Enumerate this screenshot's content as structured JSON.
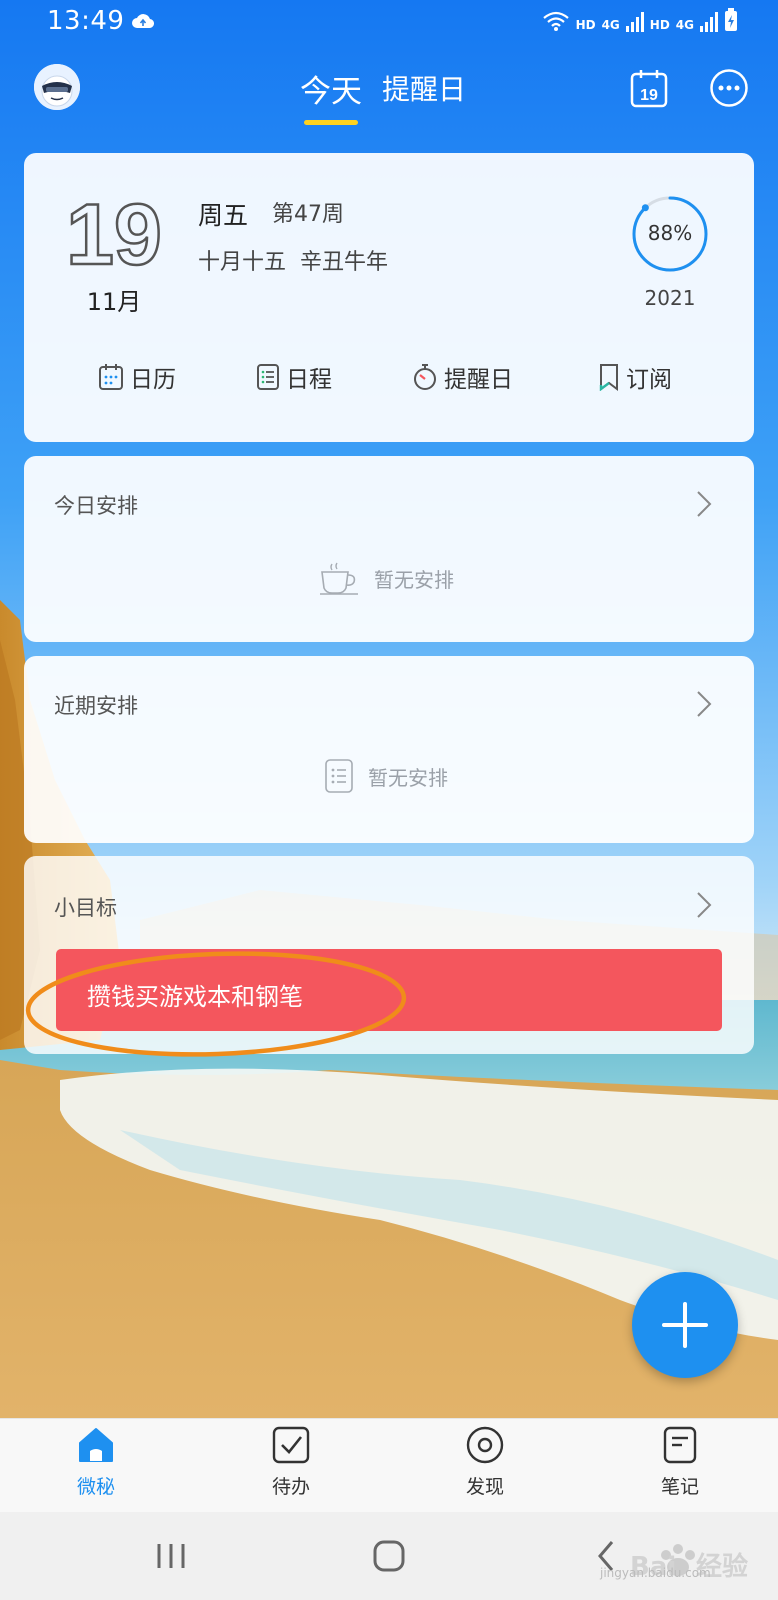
{
  "status_bar": {
    "time": "13:49",
    "network_labels": [
      "HD",
      "4G",
      "HD",
      "4G"
    ]
  },
  "header": {
    "tabs": [
      {
        "label": "今天",
        "active": true
      },
      {
        "label": "提醒日",
        "active": false
      }
    ],
    "calendar_icon_day": "19"
  },
  "date_card": {
    "day": "19",
    "month": "11月",
    "weekday": "周五",
    "week_number": "第47周",
    "lunar": "十月十五  辛丑牛年",
    "year_progress": 0.88,
    "year_progress_label": "88%",
    "year": "2021",
    "shortcuts": [
      {
        "label": "日历",
        "icon": "calendar-icon"
      },
      {
        "label": "日程",
        "icon": "schedule-list-icon"
      },
      {
        "label": "提醒日",
        "icon": "timer-icon"
      },
      {
        "label": "订阅",
        "icon": "bookmark-icon"
      }
    ]
  },
  "today_section": {
    "title": "今日安排",
    "empty_text": "暂无安排"
  },
  "recent_section": {
    "title": "近期安排",
    "empty_text": "暂无安排"
  },
  "goals_section": {
    "title": "小目标",
    "goal_item": "攒钱买游戏本和钢笔"
  },
  "bottom_nav": [
    {
      "label": "微秘",
      "active": true
    },
    {
      "label": "待办",
      "active": false
    },
    {
      "label": "发现",
      "active": false
    },
    {
      "label": "笔记",
      "active": false
    }
  ],
  "colors": {
    "accent": "#1e90f0",
    "tab_underline": "#ffd21f",
    "goal_bg": "#f4565d",
    "annotation": "#f08c1a"
  },
  "watermark": {
    "text": "jingyan.baidu.com"
  }
}
